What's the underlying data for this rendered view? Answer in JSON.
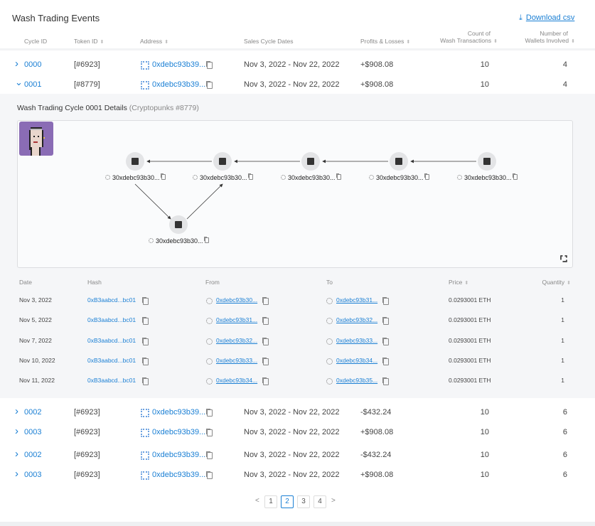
{
  "title": "Wash Trading Events",
  "download_label": "Download csv",
  "accent": "#1a7fd4",
  "columns": {
    "cycle_id": "Cycle ID",
    "token_id": "Token ID",
    "address": "Address",
    "dates": "Sales Cycle Dates",
    "pnl": "Profits & Losses",
    "count_l1": "Count of",
    "count_l2": "Wash Transactions",
    "wallets_l1": "Number of",
    "wallets_l2": "Wallets Involved"
  },
  "rows_top": [
    {
      "expanded": false,
      "cycle": "0000",
      "token": "[#6923]",
      "address": "0xdebc93b39...",
      "dates": "Nov 3, 2022 - Nov 22, 2022",
      "pnl": "+$908.08",
      "count": "10",
      "wallets": "4"
    },
    {
      "expanded": true,
      "cycle": "0001",
      "token": "[#8779]",
      "address": "0xdebc93b39...",
      "dates": "Nov 3, 2022 - Nov 22, 2022",
      "pnl": "+$908.08",
      "count": "10",
      "wallets": "4"
    }
  ],
  "details": {
    "title": "Wash Trading Cycle 0001 Details",
    "subtitle": "(Cryptopunks #8779)",
    "graph_nodes": [
      {
        "label": "30xdebc93b30..."
      },
      {
        "label": "30xdebc93b30..."
      },
      {
        "label": "30xdebc93b30..."
      },
      {
        "label": "30xdebc93b30..."
      },
      {
        "label": "30xdebc93b30..."
      },
      {
        "label": "30xdebc93b30..."
      }
    ],
    "columns": {
      "date": "Date",
      "hash": "Hash",
      "from": "From",
      "to": "To",
      "price": "Price",
      "quantity": "Quantity"
    },
    "transactions": [
      {
        "date": "Nov 3, 2022",
        "hash": "0xB3aabcd...bc01",
        "from": "0xdebc93b30...",
        "to": "0xdebc93b31...",
        "price": "0.0293001 ETH",
        "quantity": "1"
      },
      {
        "date": "Nov 5, 2022",
        "hash": "0xB3aabcd...bc01",
        "from": "0xdebc93b31...",
        "to": "0xdebc93b32...",
        "price": "0.0293001 ETH",
        "quantity": "1"
      },
      {
        "date": "Nov 7, 2022",
        "hash": "0xB3aabcd...bc01",
        "from": "0xdebc93b32...",
        "to": "0xdebc93b33...",
        "price": "0.0293001 ETH",
        "quantity": "1"
      },
      {
        "date": "Nov 10, 2022",
        "hash": "0xB3aabcd...bc01",
        "from": "0xdebc93b33...",
        "to": "0xdebc93b34...",
        "price": "0.0293001 ETH",
        "quantity": "1"
      },
      {
        "date": "Nov 11, 2022",
        "hash": "0xB3aabcd...bc01",
        "from": "0xdebc93b34...",
        "to": "0xdebc93b35...",
        "price": "0.0293001 ETH",
        "quantity": "1"
      }
    ]
  },
  "rows_bottom": [
    {
      "expanded": false,
      "cycle": "0002",
      "token": "[#6923]",
      "address": "0xdebc93b39...",
      "dates": "Nov 3, 2022 - Nov 22, 2022",
      "pnl": "-$432.24",
      "count": "10",
      "wallets": "6"
    },
    {
      "expanded": false,
      "cycle": "0003",
      "token": "[#6923]",
      "address": "0xdebc93b39...",
      "dates": "Nov 3, 2022 - Nov 22, 2022",
      "pnl": "+$908.08",
      "count": "10",
      "wallets": "6"
    },
    {
      "expanded": false,
      "cycle": "0002",
      "token": "[#6923]",
      "address": "0xdebc93b39...",
      "dates": "Nov 3, 2022 - Nov 22, 2022",
      "pnl": "-$432.24",
      "count": "10",
      "wallets": "6"
    },
    {
      "expanded": false,
      "cycle": "0003",
      "token": "[#6923]",
      "address": "0xdebc93b39...",
      "dates": "Nov 3, 2022 - Nov 22, 2022",
      "pnl": "+$908.08",
      "count": "10",
      "wallets": "6"
    }
  ],
  "pagination": {
    "pages": [
      "1",
      "2",
      "3",
      "4"
    ],
    "current": "2",
    "prev": "<",
    "next": ">"
  }
}
